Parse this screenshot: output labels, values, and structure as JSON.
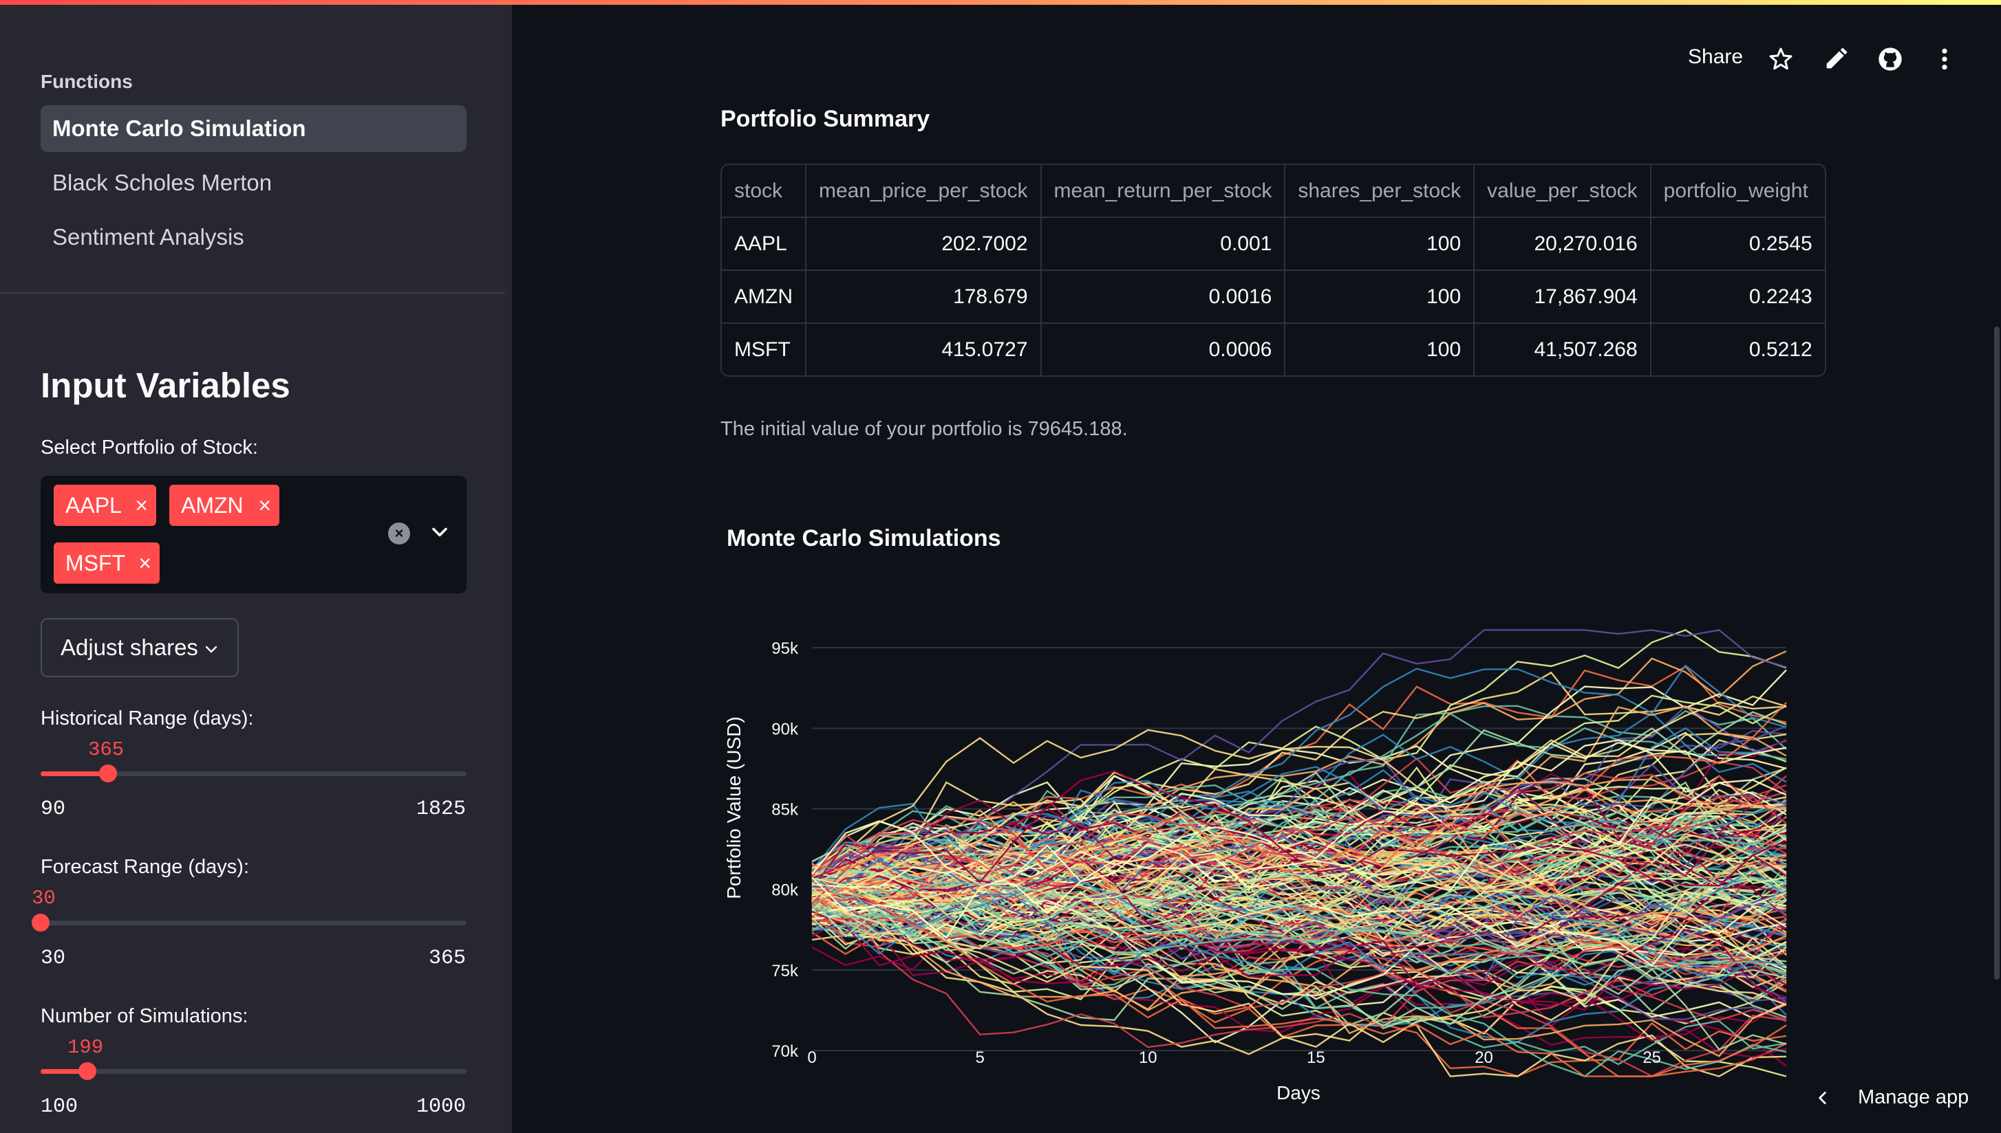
{
  "sidebar": {
    "nav_heading": "Functions",
    "nav_items": [
      {
        "label": "Monte Carlo Simulation",
        "active": true
      },
      {
        "label": "Black Scholes Merton",
        "active": false
      },
      {
        "label": "Sentiment Analysis",
        "active": false
      }
    ],
    "title": "Input Variables",
    "portfolio_label": "Select Portfolio of Stock:",
    "tags": [
      "AAPL",
      "AMZN",
      "MSFT"
    ],
    "adjust_shares_label": "Adjust shares",
    "sliders": [
      {
        "label": "Historical Range (days):",
        "value": "365",
        "min": "90",
        "max": "1825"
      },
      {
        "label": "Forecast Range (days):",
        "value": "30",
        "min": "30",
        "max": "365"
      },
      {
        "label": "Number of Simulations:",
        "value": "199",
        "min": "100",
        "max": "1000"
      }
    ]
  },
  "toolbar": {
    "share_label": "Share",
    "icons": [
      "star-icon",
      "pencil-icon",
      "github-icon",
      "more-vertical-icon"
    ]
  },
  "summary": {
    "title": "Portfolio Summary",
    "columns": [
      "stock",
      "mean_price_per_stock",
      "mean_return_per_stock",
      "shares_per_stock",
      "value_per_stock",
      "portfolio_weight"
    ],
    "rows": [
      [
        "AAPL",
        "202.7002",
        "0.001",
        "100",
        "20,270.016",
        "0.2545"
      ],
      [
        "AMZN",
        "178.679",
        "0.0016",
        "100",
        "17,867.904",
        "0.2243"
      ],
      [
        "MSFT",
        "415.0727",
        "0.0006",
        "100",
        "41,507.268",
        "0.5212"
      ]
    ],
    "info_text": "The initial value of your portfolio is 79645.188."
  },
  "chart_title": "Monte Carlo Simulations",
  "chart_data": {
    "type": "line",
    "xlabel": "Days",
    "ylabel": "Portfolio Value (USD)",
    "xlim": [
      0,
      29
    ],
    "ylim": [
      68000,
      96500
    ],
    "x_ticks": [
      0,
      5,
      10,
      15,
      20,
      25
    ],
    "y_ticks": [
      70000,
      75000,
      80000,
      85000,
      90000,
      95000
    ],
    "y_tick_labels": [
      "70k",
      "75k",
      "80k",
      "85k",
      "90k",
      "95k"
    ],
    "start_value": 79645.188,
    "num_series": 199,
    "num_days": 30,
    "grid": true,
    "palette": [
      "#9e0142",
      "#d53e4f",
      "#f46d43",
      "#fdae61",
      "#fee08b",
      "#ffffbf",
      "#e6f598",
      "#abdda4",
      "#66c2a5",
      "#3288bd",
      "#5e4fa2"
    ]
  },
  "manage_app_label": "Manage app"
}
